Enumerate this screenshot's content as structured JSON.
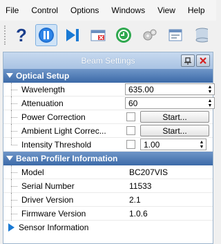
{
  "menu": {
    "items": [
      {
        "id": "file",
        "label": "File"
      },
      {
        "id": "control",
        "label": "Control"
      },
      {
        "id": "options",
        "label": "Options"
      },
      {
        "id": "windows",
        "label": "Windows"
      },
      {
        "id": "view",
        "label": "View"
      },
      {
        "id": "help",
        "label": "Help"
      }
    ]
  },
  "toolbar": {
    "buttons": [
      {
        "name": "help-icon",
        "pressed": false
      },
      {
        "name": "pause-icon",
        "pressed": true
      },
      {
        "name": "play-step-icon",
        "pressed": false
      },
      {
        "name": "close-window-icon",
        "pressed": false
      },
      {
        "name": "green-circle-icon",
        "pressed": false
      },
      {
        "name": "gears-icon",
        "pressed": false
      },
      {
        "name": "report-icon",
        "pressed": false
      },
      {
        "name": "database-icon",
        "pressed": false
      }
    ]
  },
  "panel": {
    "title": "Beam Settings",
    "categories": [
      {
        "label": "Optical Setup",
        "rows": [
          {
            "name": "Wavelength",
            "type": "spin",
            "value": "635.00"
          },
          {
            "name": "Attenuation",
            "type": "spin",
            "value": "60"
          },
          {
            "name": "Power Correction",
            "type": "check-button",
            "button": "Start..."
          },
          {
            "name": "Ambient Light Correc...",
            "type": "check-button",
            "button": "Start..."
          },
          {
            "name": "Intensity Threshold",
            "type": "check-spin",
            "value": "1.00"
          }
        ]
      },
      {
        "label": "Beam Profiler Information",
        "rows": [
          {
            "name": "Model",
            "value": "BC207VIS"
          },
          {
            "name": "Serial Number",
            "value": "11533"
          },
          {
            "name": "Driver Version",
            "value": "2.1"
          },
          {
            "name": "Firmware Version",
            "value": "1.0.6"
          }
        ]
      }
    ],
    "sub_item": "Sensor Information"
  },
  "colors": {
    "category_bar": "#3c6aa8",
    "title_bar": "#a9c3e3",
    "accent_blue": "#1a7ad4"
  }
}
